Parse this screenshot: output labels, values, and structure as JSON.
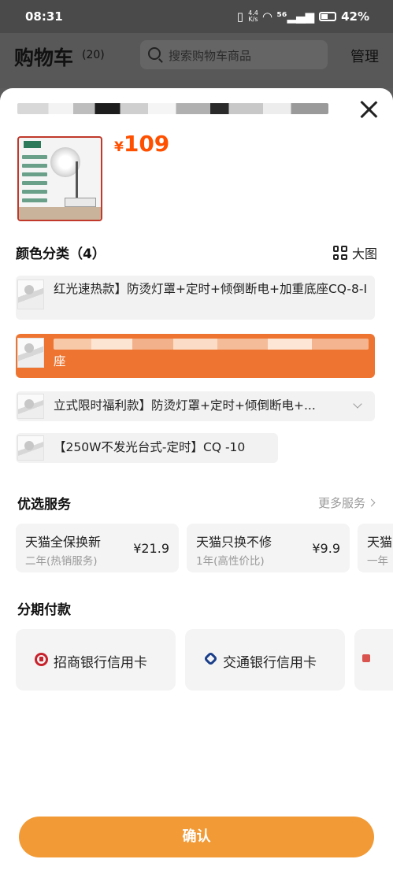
{
  "status_bar": {
    "time": "08:31",
    "net_speed_value": "4.4",
    "net_speed_unit": "K/s",
    "signal": "⁵⁶",
    "battery": "42%"
  },
  "cart_header": {
    "title": "购物车",
    "count": "(20)",
    "search_placeholder": "搜索购物车商品",
    "manage": "管理"
  },
  "product": {
    "price_symbol": "¥",
    "price": "109"
  },
  "color_section": {
    "title": "颜色分类（4）",
    "big_view": "大图",
    "options": [
      {
        "label": "红光速热款】防烫灯罩+定时+倾倒断电+加重底座CQ-8-I",
        "selected": false
      },
      {
        "label": "座",
        "selected": true
      },
      {
        "label": "立式限时福利款】防烫灯罩+定时+倾倒断电+...",
        "selected": false
      },
      {
        "label": "【250W不发光台式-定时】CQ -10",
        "selected": false
      }
    ]
  },
  "services_section": {
    "title": "优选服务",
    "more": "更多服务",
    "items": [
      {
        "name": "天猫全保换新",
        "desc": "二年(热销服务)",
        "price": "¥21.9"
      },
      {
        "name": "天猫只换不修",
        "desc": "1年(高性价比)",
        "price": "¥9.9"
      },
      {
        "name": "天猫",
        "desc": "一年",
        "price": ""
      }
    ]
  },
  "installment_section": {
    "title": "分期付款",
    "banks": [
      {
        "name": "招商银行信用卡",
        "icon": "cmb-bank-icon"
      },
      {
        "name": "交通银行信用卡",
        "icon": "bocom-bank-icon"
      },
      {
        "name": "",
        "icon": "bank-icon"
      }
    ]
  },
  "confirm_label": "确认",
  "colors": {
    "accent": "#ff5000",
    "selected_option": "#ee7531",
    "confirm_button": "#f29a35"
  }
}
